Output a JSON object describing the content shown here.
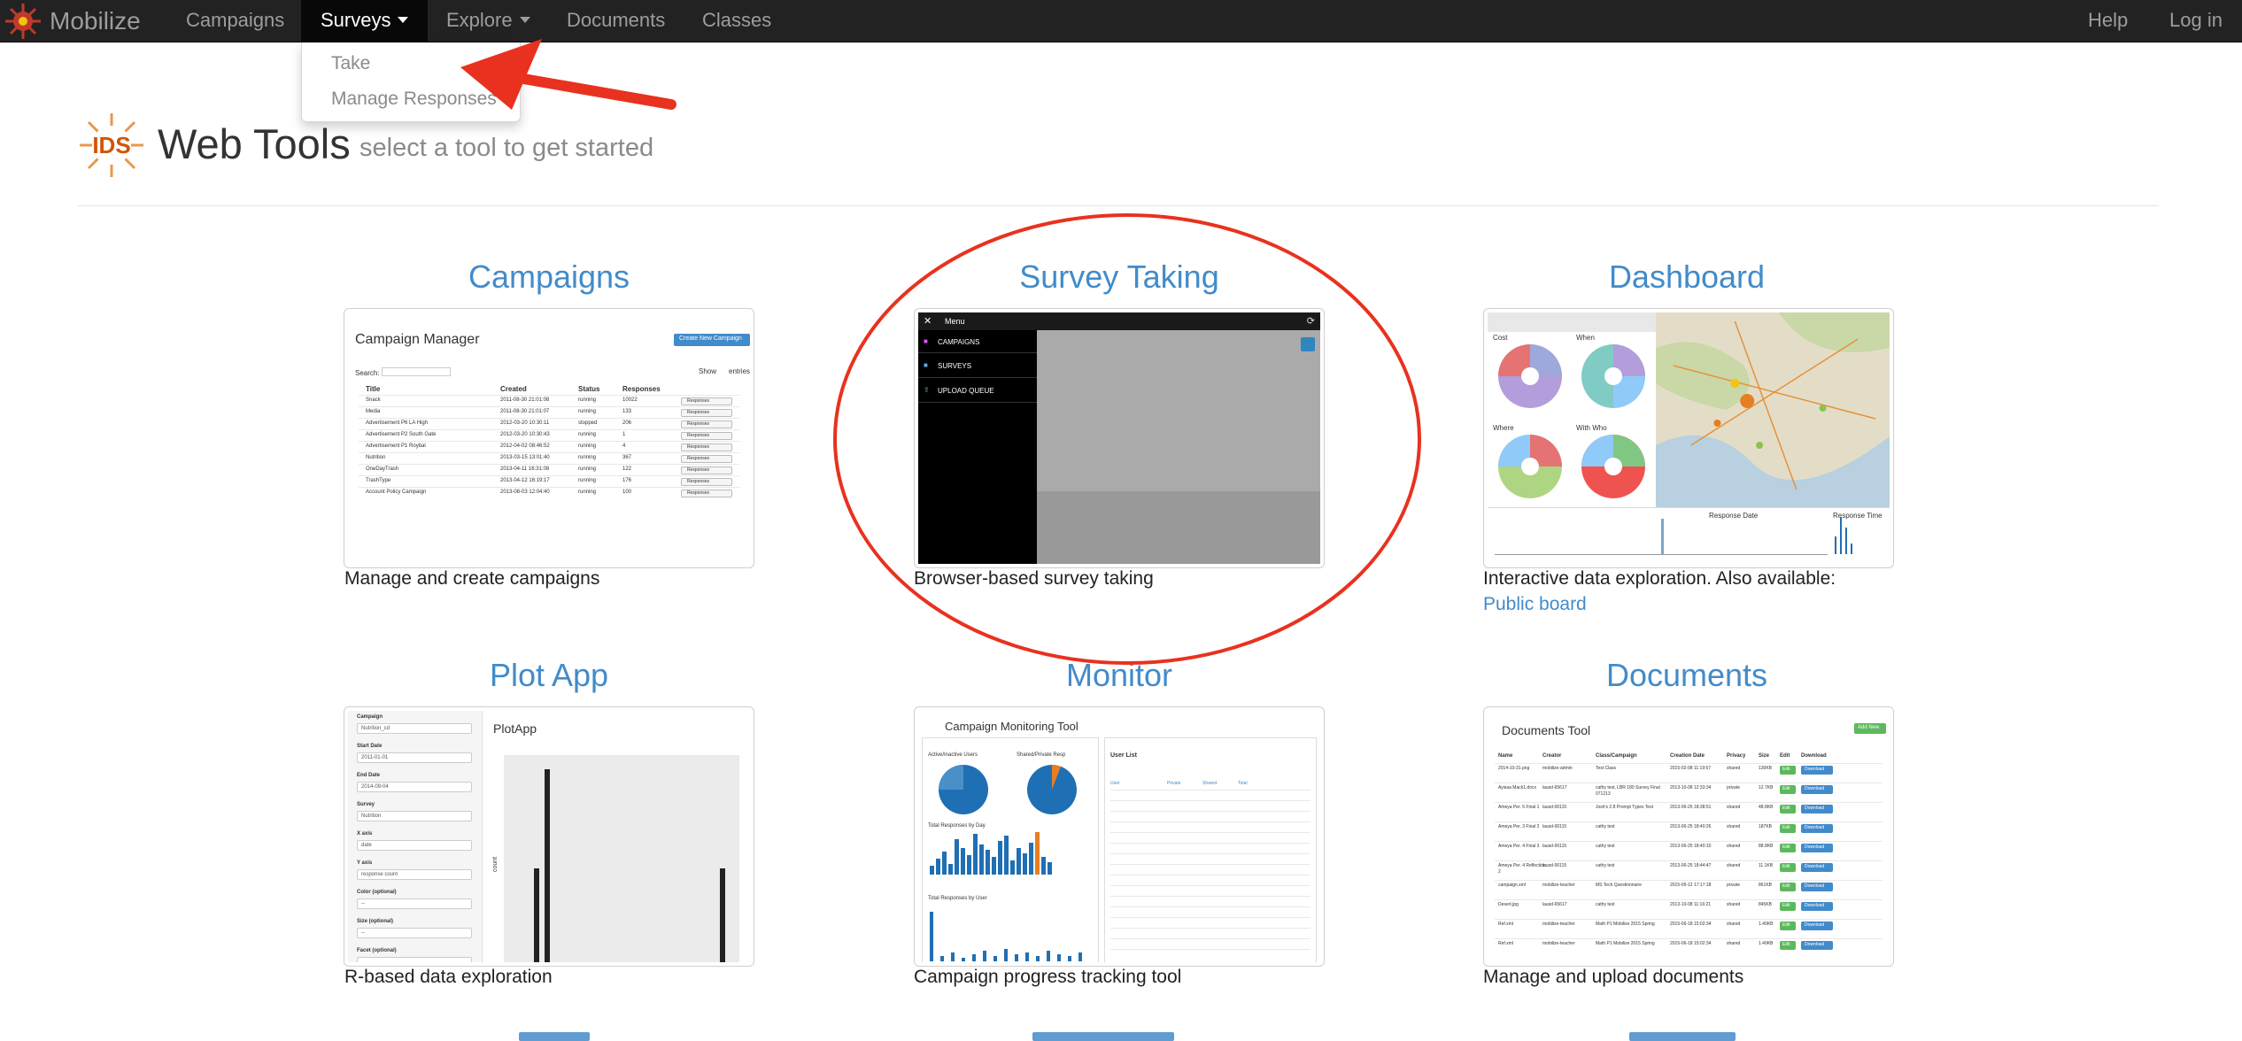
{
  "navbar": {
    "brand": "Mobilize",
    "items": [
      {
        "label": "Campaigns"
      },
      {
        "label": "Surveys"
      },
      {
        "label": "Explore"
      },
      {
        "label": "Documents"
      },
      {
        "label": "Classes"
      }
    ],
    "help": "Help",
    "login": "Log in",
    "dropdown": [
      "Take",
      "Manage Responses"
    ]
  },
  "header": {
    "logo_text": "IDS",
    "title": "Web Tools",
    "subtitle": "select a tool to get started"
  },
  "tools": [
    {
      "title": "Campaigns",
      "desc": "Manage and create campaigns"
    },
    {
      "title": "Survey Taking",
      "desc": "Browser-based survey taking"
    },
    {
      "title": "Dashboard",
      "desc": "Interactive data exploration. Also available:",
      "link": "Public board"
    },
    {
      "title": "Plot App",
      "desc": "R-based data exploration"
    },
    {
      "title": "Monitor",
      "desc": "Campaign progress tracking tool"
    },
    {
      "title": "Documents",
      "desc": "Manage and upload documents"
    }
  ],
  "thumbs": {
    "campaign_manager": {
      "heading": "Campaign Manager",
      "create": "Create New Campaign",
      "search": "Search:",
      "show": "Show",
      "entries": "entries",
      "columns": [
        "Title",
        "Created",
        "Status",
        "Responses"
      ],
      "rows": [
        [
          "Snack",
          "2011-08-30 21:01:08",
          "running",
          "10022"
        ],
        [
          "Media",
          "2011-08-30 21:01:07",
          "running",
          "133"
        ],
        [
          "Advertisement P6 LA High",
          "2012-03-20 10:30:11",
          "stopped",
          "206"
        ],
        [
          "Advertisement P2 South Gate",
          "2012-03-20 10:30:43",
          "running",
          "1"
        ],
        [
          "Advertisement P1 Roybal",
          "2012-04-02 08:46:52",
          "running",
          "4"
        ],
        [
          "Nutrition",
          "2013-03-15 13:01:40",
          "running",
          "367"
        ],
        [
          "OneDayTrash",
          "2013-04-11 16:31:08",
          "running",
          "122"
        ],
        [
          "TrashType",
          "2013-04-12 16:19:17",
          "running",
          "176"
        ],
        [
          "Account Policy Campaign",
          "2013-08-03 12:04:40",
          "running",
          "100"
        ]
      ],
      "action": "Responses"
    },
    "survey": {
      "menu": "Menu",
      "items": [
        "CAMPAIGNS",
        "SURVEYS",
        "UPLOAD QUEUE"
      ]
    },
    "dashboard": {
      "charts": [
        "Cost",
        "When",
        "Where",
        "With Who"
      ],
      "hist1": "Response Date",
      "hist2": "Response Time"
    },
    "plotapp": {
      "heading": "PlotApp",
      "fields": [
        {
          "label": "Campaign",
          "value": "Nutrition_cd"
        },
        {
          "label": "Start Date",
          "value": "2011-01-01"
        },
        {
          "label": "End Date",
          "value": "2014-09-04"
        },
        {
          "label": "Survey",
          "value": "Nutrition"
        },
        {
          "label": "X axis",
          "value": "date"
        },
        {
          "label": "Y axis",
          "value": "response count"
        },
        {
          "label": "Color (optional)",
          "value": "--"
        },
        {
          "label": "Size (optional)",
          "value": "--"
        },
        {
          "label": "Facet (optional)",
          "value": ""
        }
      ],
      "ylabel": "count"
    },
    "monitor": {
      "heading": "Campaign Monitoring Tool",
      "active_users": "Active/Inactive Users",
      "shared": "Shared/Private Resp",
      "by_day": "Total Responses by Day",
      "by_user": "Total Responses by User",
      "user_list": "User List",
      "user_columns": [
        "User",
        "Private",
        "Shared",
        "Total"
      ]
    },
    "documents": {
      "heading": "Documents Tool",
      "add": "Add New",
      "columns": [
        "Name",
        "Creator",
        "Class/Campaign",
        "Creation Date",
        "Privacy",
        "Size",
        "Edit",
        "Download"
      ],
      "rows": [
        [
          "2014-10-31.png",
          "mobilize-admin",
          "Test Class",
          "2015-02-08 11:19:57",
          "shared",
          "130KB"
        ],
        [
          "Aysiaa Mack1.docx",
          "lausd-65617",
          "cathy test, LBR 180 Survey Final 071213",
          "2013-10-08 12:33:34",
          "private",
          "12.7KB"
        ],
        [
          "Ameya Per. 5 Final 1",
          "lausd-00115",
          "Josh's 2.8 Prompt Types Test",
          "2013-06-25 18:38:51",
          "shared",
          "48.8KB"
        ],
        [
          "Ameya Per. 3 Final 2",
          "lausd-00115",
          "cathy test",
          "2013-06-25 18:40:26",
          "shared",
          "187KB"
        ],
        [
          "Ameya Per. 4 Final 3",
          "lausd-00115",
          "cathy test",
          "2013-06-25 18:40:10",
          "shared",
          "88.8KB"
        ],
        [
          "Ameya Per. 4 Reflection 2",
          "lausd-00115",
          "cathy test",
          "2013-06-25 18:44:47",
          "shared",
          "11.1KB"
        ],
        [
          "campaign.xml",
          "mobilize-teacher",
          "MS Tech Questionnaire",
          "2015-05-12 17:17:18",
          "private",
          "861KB"
        ],
        [
          "Desert.jpg",
          "lausd-65617",
          "cathy test",
          "2013-10-08 11:16:21",
          "shared",
          "845KB"
        ],
        [
          "Ref.xml",
          "mobilize-teacher",
          "Math P1 Mobilize 2015 Spring",
          "2015-06-18 15:02:34",
          "shared",
          "1.40KB"
        ],
        [
          "Ref.xml",
          "mobilize-teacher",
          "Math P1 Mobilize 2015 Spring",
          "2015-06-18 15:02:34",
          "shared",
          "1.40KB"
        ]
      ],
      "edit": "Edit",
      "download": "Download"
    }
  },
  "colors": {
    "navbar": "#222222",
    "link": "#428bca",
    "annotation": "#e8321f"
  }
}
